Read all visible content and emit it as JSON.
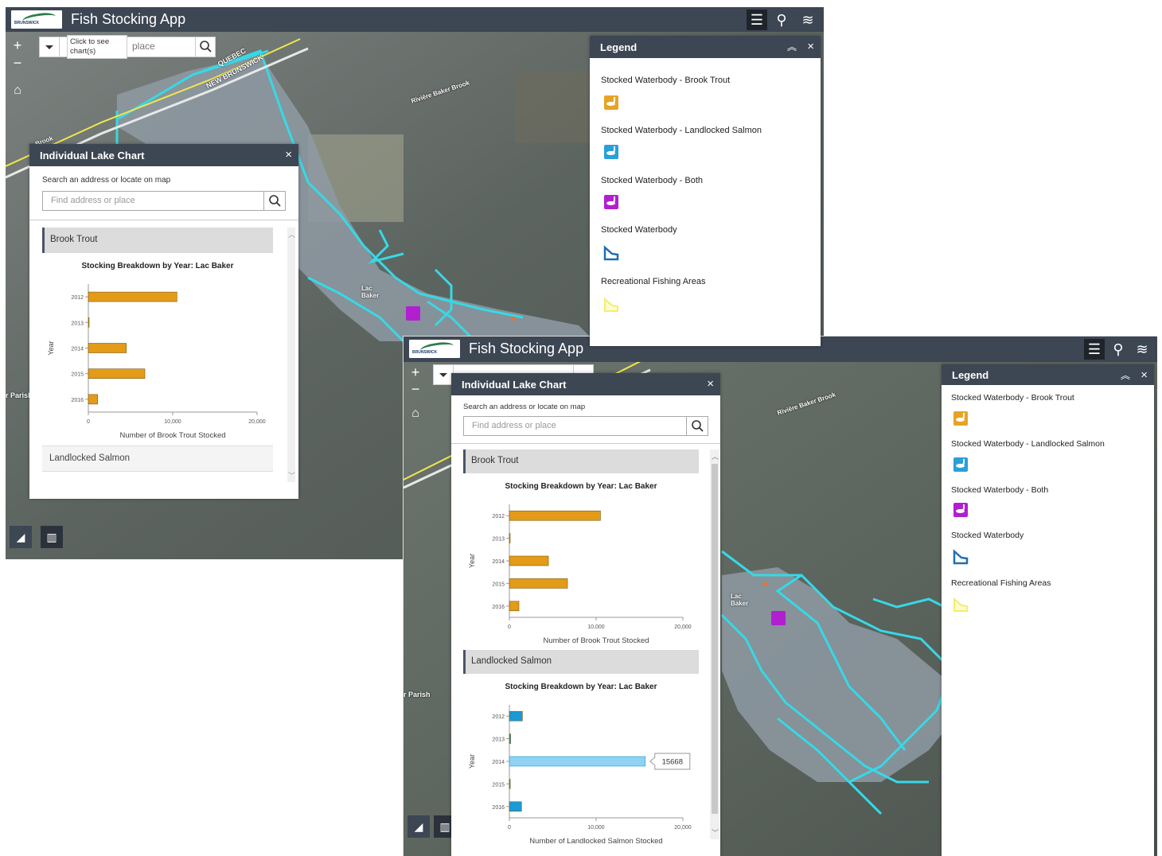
{
  "app": {
    "title": "Fish Stocking App",
    "logo_text": "BRUNSWICK"
  },
  "header_buttons": [
    {
      "icon": "legend-list-icon",
      "label": "Legend"
    },
    {
      "icon": "pin-icon",
      "label": "Location"
    },
    {
      "icon": "layers-icon",
      "label": "Layers"
    }
  ],
  "search": {
    "placeholder": "Find address or place",
    "tooltip": "Click to see chart(s)",
    "visible_fragment": "place",
    "hint": "Search an address or locate on map"
  },
  "panel": {
    "title": "Individual Lake Chart",
    "close": "×"
  },
  "sections": {
    "brook_trout": "Brook Trout",
    "landlocked_salmon": "Landlocked Salmon"
  },
  "legend": {
    "title": "Legend",
    "collapse": "︽",
    "close": "×",
    "items": [
      {
        "label": "Stocked Waterbody - Brook Trout",
        "color": "#e8a325",
        "symbol": "fish"
      },
      {
        "label": "Stocked Waterbody - Landlocked Salmon",
        "color": "#2a9fd8",
        "symbol": "fish"
      },
      {
        "label": "Stocked Waterbody - Both",
        "color": "#b21fd1",
        "symbol": "fish"
      },
      {
        "label": "Stocked Waterbody",
        "color": "#1f6fb4",
        "symbol": "polygon"
      },
      {
        "label": "Recreational Fishing Areas",
        "color": "#f4ee6a",
        "symbol": "polygon"
      }
    ]
  },
  "map_labels": {
    "quebec": "QUEBEC",
    "new_brunswick": "NEW BRUNSWICK",
    "baker_brook": "Rivière Baker Brook",
    "lac_baker": "Lac Baker",
    "parish": "r Parish",
    "brook": "n Brook"
  },
  "chart_data": [
    {
      "type": "bar",
      "title": "Stocking Breakdown by Year: Lac Baker",
      "xlabel": "Number of Brook Trout Stocked",
      "ylabel": "Year",
      "categories": [
        "2012",
        "2013",
        "2014",
        "2015",
        "2016"
      ],
      "values": [
        10500,
        0,
        4500,
        6700,
        1100
      ],
      "xlim": [
        0,
        20000
      ],
      "xticks": [
        "0",
        "10,000",
        "20,000"
      ],
      "color": "#e39b18"
    },
    {
      "type": "bar",
      "title": "Stocking Breakdown by Year: Lac Baker",
      "xlabel": "Number of Landlocked Salmon Stocked",
      "ylabel": "Year",
      "categories": [
        "2012",
        "2013",
        "2014",
        "2015",
        "2016"
      ],
      "values": [
        1500,
        150,
        15668,
        100,
        1400
      ],
      "xlim": [
        0,
        20000
      ],
      "xticks": [
        "0",
        "10,000",
        "20,000"
      ],
      "color": "#1a9ad6",
      "highlight_color": "#8fd2f2",
      "highlight_index": 2,
      "tooltip": "15668"
    }
  ]
}
